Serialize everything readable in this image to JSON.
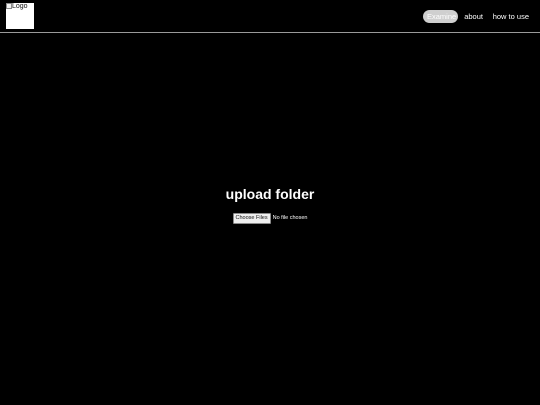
{
  "header": {
    "logo_alt": "Logo",
    "nav": [
      {
        "label": "Examine",
        "active": true
      },
      {
        "label": "about",
        "active": false
      },
      {
        "label": "how to use",
        "active": false
      }
    ]
  },
  "main": {
    "title": "upload folder",
    "file_input": {
      "button_label": "Choose Files",
      "status": "No file chosen"
    }
  },
  "colors": {
    "background": "#000000",
    "text": "#ffffff",
    "active_nav_bg": "#cfcfcf",
    "divider": "#9a9a9a"
  }
}
